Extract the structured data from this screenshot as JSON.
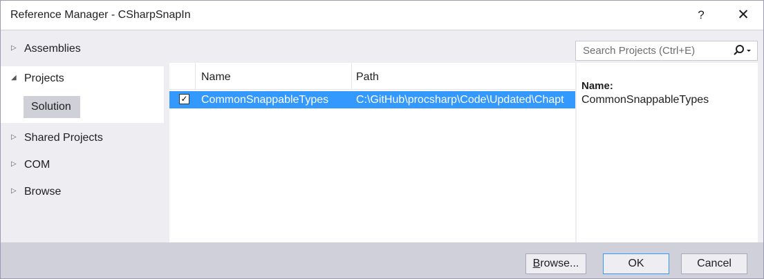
{
  "window": {
    "title": "Reference Manager - CSharpSnapIn",
    "help_label": "?",
    "close_label": "✕"
  },
  "nav": {
    "assemblies": "Assemblies",
    "projects": "Projects",
    "solution": "Solution",
    "shared_projects": "Shared Projects",
    "com": "COM",
    "browse": "Browse"
  },
  "search": {
    "placeholder": "Search Projects (Ctrl+E)"
  },
  "list": {
    "columns": [
      "Name",
      "Path"
    ],
    "rows": [
      {
        "checked": true,
        "name": "CommonSnappableTypes",
        "path": "C:\\GitHub\\procsharp\\Code\\Updated\\Chapt"
      }
    ]
  },
  "details": {
    "name_label": "Name:",
    "name_value": "CommonSnappableTypes"
  },
  "footer": {
    "browse_prefix": "B",
    "browse_rest": "rowse...",
    "ok": "OK",
    "cancel": "Cancel"
  },
  "colors": {
    "selection": "#3399ff",
    "panel": "#eeeef2",
    "footer": "#cfd0da"
  }
}
